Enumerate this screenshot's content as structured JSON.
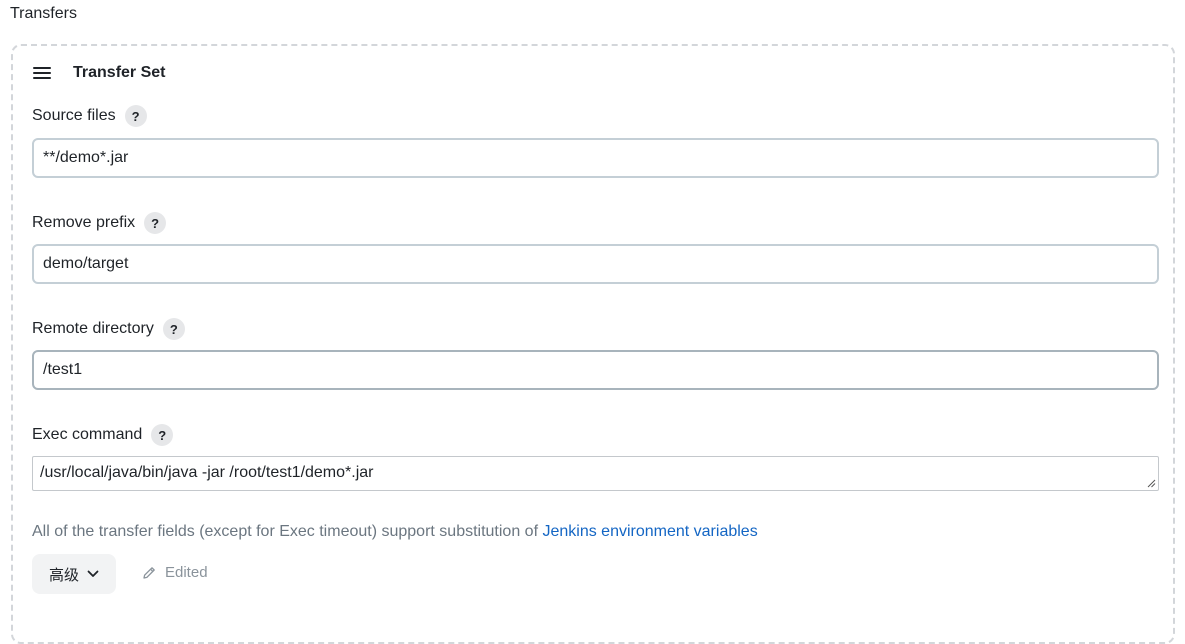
{
  "section": {
    "title": "Transfers"
  },
  "transfer_set": {
    "title": "Transfer Set",
    "source_files": {
      "label": "Source files",
      "value": "**/demo*.jar"
    },
    "remove_prefix": {
      "label": "Remove prefix",
      "value": "demo/target"
    },
    "remote_directory": {
      "label": "Remote directory",
      "value": "/test1"
    },
    "exec_command": {
      "label": "Exec command",
      "value": "/usr/local/java/bin/java -jar /root/test1/demo*.jar"
    },
    "help_glyph": "?",
    "info_text": "All of the transfer fields (except for Exec timeout) support substitution of ",
    "info_link": "Jenkins environment variables",
    "advanced_label": "高级",
    "edited_label": "Edited"
  },
  "colors": {
    "link": "#1466c4",
    "muted_text": "#6b7680",
    "dashed_border": "#d3d6da"
  },
  "icons": {
    "drag_handle": "drag-handle-icon",
    "help": "help-icon",
    "chevron": "chevron-down-icon",
    "pencil": "pencil-icon",
    "resize": "resize-grip-icon"
  }
}
